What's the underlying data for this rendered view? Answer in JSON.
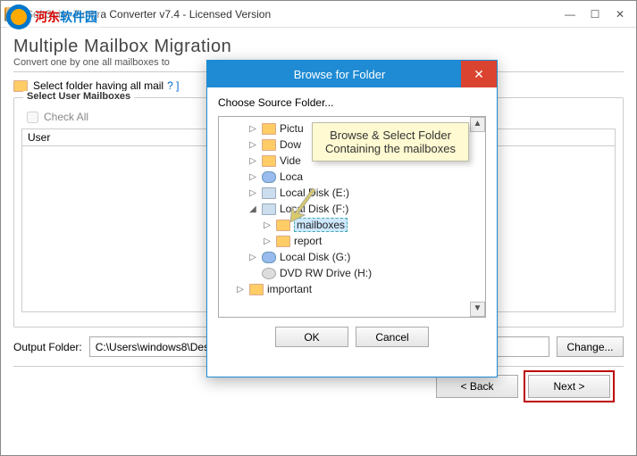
{
  "watermark": {
    "cn": "河东",
    "net": "软件园"
  },
  "title": "SoftSpire Zimbra Converter v7.4 - Licensed Version",
  "heading": "Multiple Mailbox Migration",
  "subheading": "Convert one by one all mailboxes to",
  "select_text": "Select folder having all mail",
  "select_help": "? ]",
  "group_title": "Select User Mailboxes",
  "check_all": "Check All",
  "list_header": "User",
  "output_label": "Output Folder:",
  "output_path": "C:\\Users\\windows8\\Desktop",
  "change_btn": "Change...",
  "back_btn": "< Back",
  "next_btn": "Next >",
  "modal": {
    "title": "Browse for Folder",
    "prompt": "Choose Source Folder...",
    "ok": "OK",
    "cancel": "Cancel",
    "callout": "Browse & Select Folder Containing the mailboxes",
    "tree": [
      {
        "label": "Pictu",
        "icon": "folder",
        "indent": 1,
        "exp": "▷"
      },
      {
        "label": "Dow",
        "icon": "folder",
        "indent": 1,
        "exp": "▷"
      },
      {
        "label": "Vide",
        "icon": "folder",
        "indent": 1,
        "exp": "▷"
      },
      {
        "label": "Loca",
        "icon": "net",
        "indent": 1,
        "exp": "▷"
      },
      {
        "label": "Local Disk (E:)",
        "icon": "drive",
        "indent": 1,
        "exp": "▷"
      },
      {
        "label": "Local Disk (F:)",
        "icon": "drive",
        "indent": 1,
        "exp": "◢"
      },
      {
        "label": "mailboxes",
        "icon": "folder",
        "indent": 2,
        "exp": "▷",
        "selected": true
      },
      {
        "label": "report",
        "icon": "folder",
        "indent": 2,
        "exp": "▷"
      },
      {
        "label": "Local Disk (G:)",
        "icon": "net",
        "indent": 1,
        "exp": "▷"
      },
      {
        "label": "DVD RW Drive (H:)",
        "icon": "dvd",
        "indent": 1,
        "exp": ""
      },
      {
        "label": "important",
        "icon": "folder",
        "indent": 0,
        "exp": "▷"
      }
    ]
  }
}
